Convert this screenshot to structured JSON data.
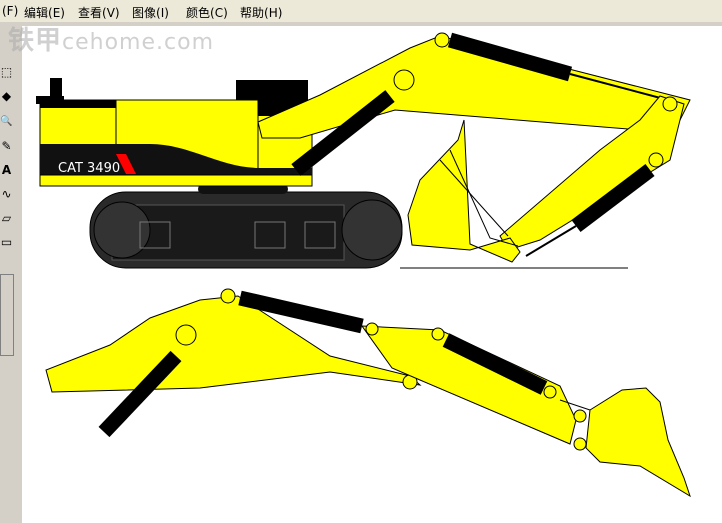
{
  "menu": [
    {
      "label": "(F)",
      "key": "F"
    },
    {
      "label": "编辑",
      "suffix": "(E)"
    },
    {
      "label": "查看",
      "suffix": "(V)"
    },
    {
      "label": "图像",
      "suffix": "(I)"
    },
    {
      "label": "颜色",
      "suffix": "(C)"
    },
    {
      "label": "帮助",
      "suffix": "(H)"
    }
  ],
  "watermark": {
    "brand": "铁甲",
    "site": "cehome.com"
  },
  "tools": {
    "select": "⬚",
    "fill": "◆",
    "zoom": "🔍",
    "brush": "✎",
    "text": "A",
    "curve": "∿",
    "polygon": "▱",
    "round_rect": "▭"
  },
  "drawing": {
    "model_label": "CAT 3490"
  },
  "colors": {
    "yellow": "#ffff00",
    "black": "#000000",
    "dark": "#2a2a2a",
    "red": "#ff0000"
  }
}
